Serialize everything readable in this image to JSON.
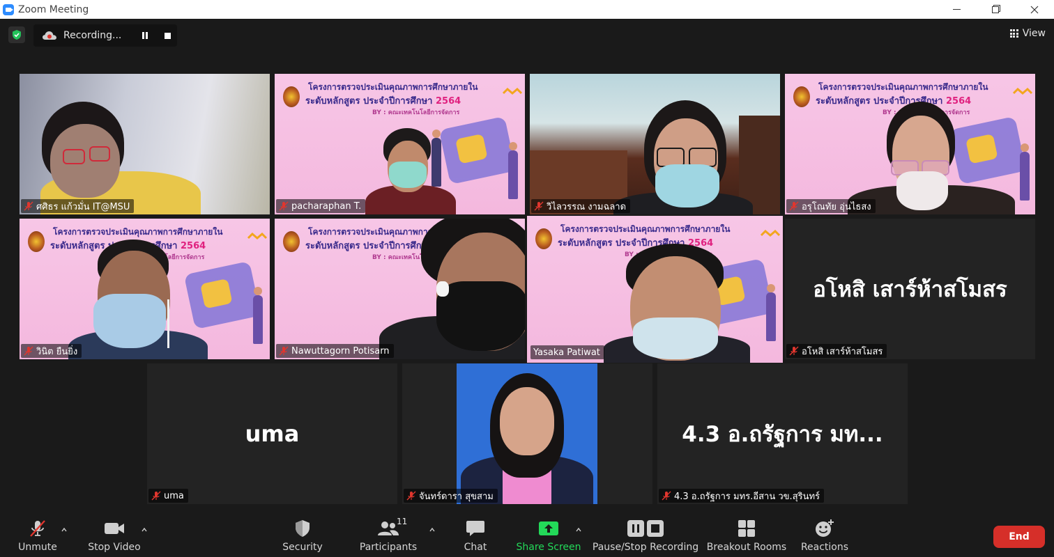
{
  "window": {
    "title": "Zoom Meeting"
  },
  "recording": {
    "label": "Recording..."
  },
  "view": {
    "label": "View"
  },
  "tiles": [
    {
      "name": "ศศิธร แก้วมั่น IT@MSU"
    },
    {
      "name": "pacharaphan T."
    },
    {
      "name": "วิไลวรรณ งามฉลาด"
    },
    {
      "name": "อรุโณทัย อุ่นไธสง"
    },
    {
      "name": "วินิต ยืนยิ่ง"
    },
    {
      "name": "Nawuttagorn Potisarn"
    },
    {
      "name": "Yasaka Patiwat"
    },
    {
      "name": "อโหสิ เสาร์ห้าสโมสร",
      "display": "อโหสิ เสาร์ห้าสโมสร"
    },
    {
      "name": "uma",
      "display": "uma"
    },
    {
      "name": "จันทร์ดารา สุขสาม"
    },
    {
      "name": "4.3 อ.ถรัฐการ มทร.อีสาน วข.สุรินทร์",
      "display": "4.3 อ.ถรัฐการ มท..."
    }
  ],
  "slide": {
    "line1": "โครงการตรวจประเมินคุณภาพการศึกษาภายใน",
    "line2_prefix": "ระดับหลักสูตร ประจำปีการศึกษา",
    "line2_year": "2564",
    "line3": "BY : คณะเทคโนโลยีการจัดการ"
  },
  "toolbar": {
    "unmute": "Unmute",
    "stop_video": "Stop Video",
    "security": "Security",
    "participants": "Participants",
    "participants_count": "11",
    "chat": "Chat",
    "share_screen": "Share Screen",
    "pause_stop_recording": "Pause/Stop Recording",
    "breakout_rooms": "Breakout Rooms",
    "reactions": "Reactions",
    "end": "End"
  },
  "colors": {
    "background": "#1a1a1a",
    "tile": "#232323",
    "active_speaker": "#c8dc3c",
    "share_green": "#23d959",
    "end_red": "#d62f29",
    "mic_off_red": "#e0362e"
  },
  "icons": {
    "mic_off": "mic-off-icon",
    "video": "video-camera-icon",
    "security": "shield-icon",
    "participants": "people-icon",
    "chat": "chat-bubble-icon",
    "share": "share-screen-icon",
    "recording": "pause-stop-icon",
    "breakout": "grid-rooms-icon",
    "reactions": "smiley-plus-icon"
  }
}
